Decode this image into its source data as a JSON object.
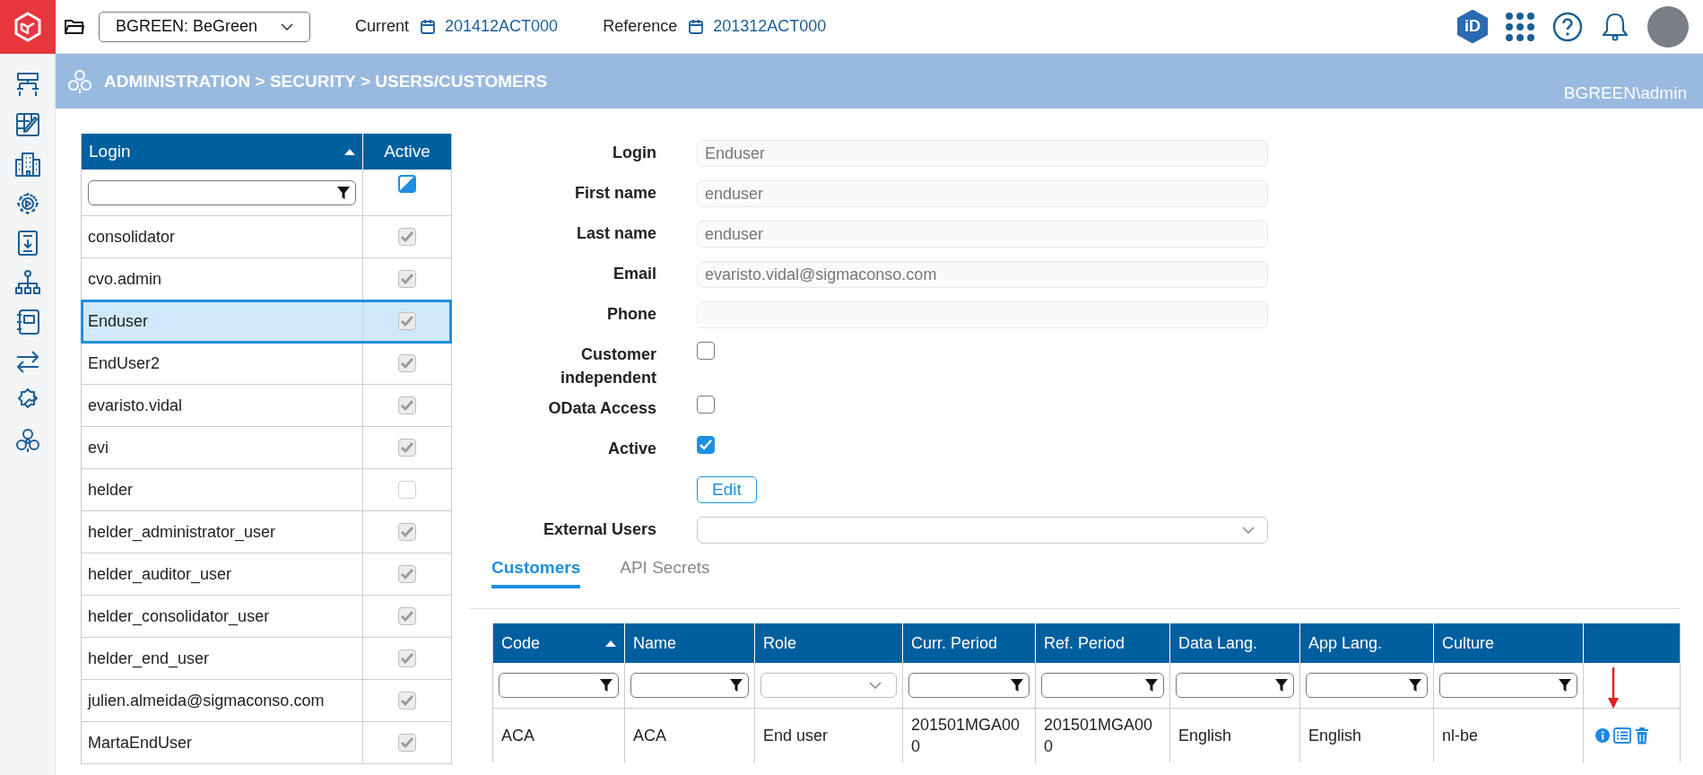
{
  "topbar": {
    "project": "BGREEN: BeGreen",
    "current_label": "Current",
    "current_value": "201412ACT000",
    "reference_label": "Reference",
    "reference_value": "201312ACT000",
    "id_badge": "iD"
  },
  "breadcrumb": {
    "path": "ADMINISTRATION > SECURITY > USERS/CUSTOMERS",
    "user": "BGREEN\\admin"
  },
  "users_table": {
    "columns": [
      {
        "label": "Login",
        "sorted": true
      },
      {
        "label": "Active",
        "sorted": false
      }
    ],
    "active_filter_partial": true,
    "rows": [
      {
        "login": "consolidator",
        "active": true,
        "selected": false
      },
      {
        "login": "cvo.admin",
        "active": true,
        "selected": false
      },
      {
        "login": "Enduser",
        "active": true,
        "selected": true
      },
      {
        "login": "EndUser2",
        "active": true,
        "selected": false
      },
      {
        "login": "evaristo.vidal",
        "active": true,
        "selected": false
      },
      {
        "login": "evi",
        "active": true,
        "selected": false
      },
      {
        "login": "helder",
        "active": false,
        "selected": false
      },
      {
        "login": "helder_administrator_user",
        "active": true,
        "selected": false
      },
      {
        "login": "helder_auditor_user",
        "active": true,
        "selected": false
      },
      {
        "login": "helder_consolidator_user",
        "active": true,
        "selected": false
      },
      {
        "login": "helder_end_user",
        "active": true,
        "selected": false
      },
      {
        "login": "julien.almeida@sigmaconso.com",
        "active": true,
        "selected": false
      },
      {
        "login": "MartaEndUser",
        "active": true,
        "selected": false
      }
    ]
  },
  "form": {
    "fields": [
      {
        "kind": "text",
        "label": "Login",
        "value": "Enduser"
      },
      {
        "kind": "text",
        "label": "First name",
        "value": "enduser"
      },
      {
        "kind": "text",
        "label": "Last name",
        "value": "enduser"
      },
      {
        "kind": "text",
        "label": "Email",
        "value": "evaristo.vidal@sigmaconso.com"
      },
      {
        "kind": "text",
        "label": "Phone"
      },
      {
        "kind": "checkbox",
        "label": "Customer independent",
        "checked": false
      },
      {
        "kind": "checkbox",
        "label": "OData Access",
        "checked": false
      },
      {
        "kind": "checkbox",
        "label": "Active",
        "checked": true
      },
      {
        "kind": "button",
        "label": "Edit"
      },
      {
        "kind": "select",
        "label": "External Users"
      }
    ]
  },
  "tabs": [
    {
      "label": "Customers",
      "selected": true
    },
    {
      "label": "API Secrets",
      "selected": false
    }
  ],
  "customers_table": {
    "columns": [
      {
        "label": "Code",
        "sorted": true,
        "kind": "text"
      },
      {
        "label": "Name",
        "sorted": false,
        "kind": "text"
      },
      {
        "label": "Role",
        "sorted": false,
        "kind": "select"
      },
      {
        "label": "Curr. Period",
        "sorted": false,
        "kind": "text"
      },
      {
        "label": "Ref. Period",
        "sorted": false,
        "kind": "text"
      },
      {
        "label": "Data Lang.",
        "sorted": false,
        "kind": "text"
      },
      {
        "label": "App Lang.",
        "sorted": false,
        "kind": "text"
      },
      {
        "label": "Culture",
        "sorted": false,
        "kind": "text"
      },
      {
        "kind": "actions"
      }
    ],
    "rows": [
      {
        "cells": [
          "ACA",
          "ACA",
          "End user",
          "201501MGA000",
          "201501MGA000",
          "English",
          "English",
          "nl-be"
        ]
      }
    ]
  }
}
